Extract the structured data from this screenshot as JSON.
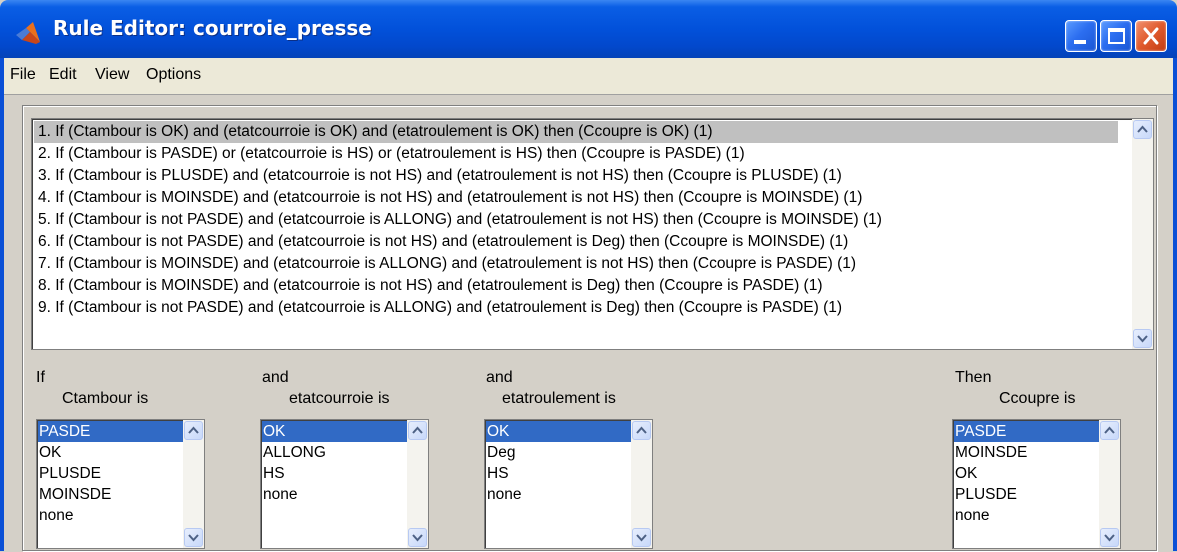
{
  "window": {
    "title": "Rule Editor: courroie_presse"
  },
  "menu": {
    "items": [
      {
        "label": "File"
      },
      {
        "label": "Edit"
      },
      {
        "label": "View"
      },
      {
        "label": "Options"
      }
    ]
  },
  "rules": {
    "selected_index": 0,
    "items": [
      "1. If (Ctambour is OK) and (etatcourroie is OK) and (etatroulement is OK) then (Ccoupre is OK) (1)",
      "2. If (Ctambour is PASDE) or (etatcourroie is HS) or (etatroulement is HS) then (Ccoupre is PASDE) (1)",
      "3. If (Ctambour is PLUSDE) and (etatcourroie is not HS) and (etatroulement is not HS) then (Ccoupre is PLUSDE) (1)",
      "4. If (Ctambour is MOINSDE) and (etatcourroie is not HS) and (etatroulement is not HS) then (Ccoupre is MOINSDE) (1)",
      "5. If (Ctambour is not PASDE) and (etatcourroie is ALLONG) and (etatroulement is not HS) then (Ccoupre is MOINSDE) (1)",
      "6. If (Ctambour is not PASDE) and (etatcourroie is not HS) and (etatroulement is Deg) then (Ccoupre is MOINSDE) (1)",
      "7. If (Ctambour is MOINSDE) and (etatcourroie is ALLONG) and (etatroulement is not HS) then (Ccoupre is PASDE) (1)",
      "8. If (Ctambour is MOINSDE) and (etatcourroie is not HS) and (etatroulement is Deg) then (Ccoupre is PASDE) (1)",
      "9. If (Ctambour is not PASDE) and (etatcourroie is ALLONG) and (etatroulement is Deg) then (Ccoupre is PASDE) (1)"
    ]
  },
  "inputs": [
    {
      "connective": "If",
      "variable_label": "Ctambour is",
      "options": [
        "PASDE",
        "OK",
        "PLUSDE",
        "MOINSDE",
        "none"
      ],
      "selected_index": 0
    },
    {
      "connective": "and",
      "variable_label": "etatcourroie is",
      "options": [
        "OK",
        "ALLONG",
        "HS",
        "none"
      ],
      "selected_index": 0
    },
    {
      "connective": "and",
      "variable_label": "etatroulement is",
      "options": [
        "OK",
        "Deg",
        "HS",
        "none"
      ],
      "selected_index": 0
    }
  ],
  "output": {
    "connective": "Then",
    "variable_label": "Ccoupre is",
    "options": [
      "PASDE",
      "MOINSDE",
      "OK",
      "PLUSDE",
      "none"
    ],
    "selected_index": 0
  },
  "colors": {
    "titlebar": "#0251da",
    "selection": "#316ac5",
    "rule_selection": "#c0c0c0",
    "panel": "#d4d0c8"
  }
}
